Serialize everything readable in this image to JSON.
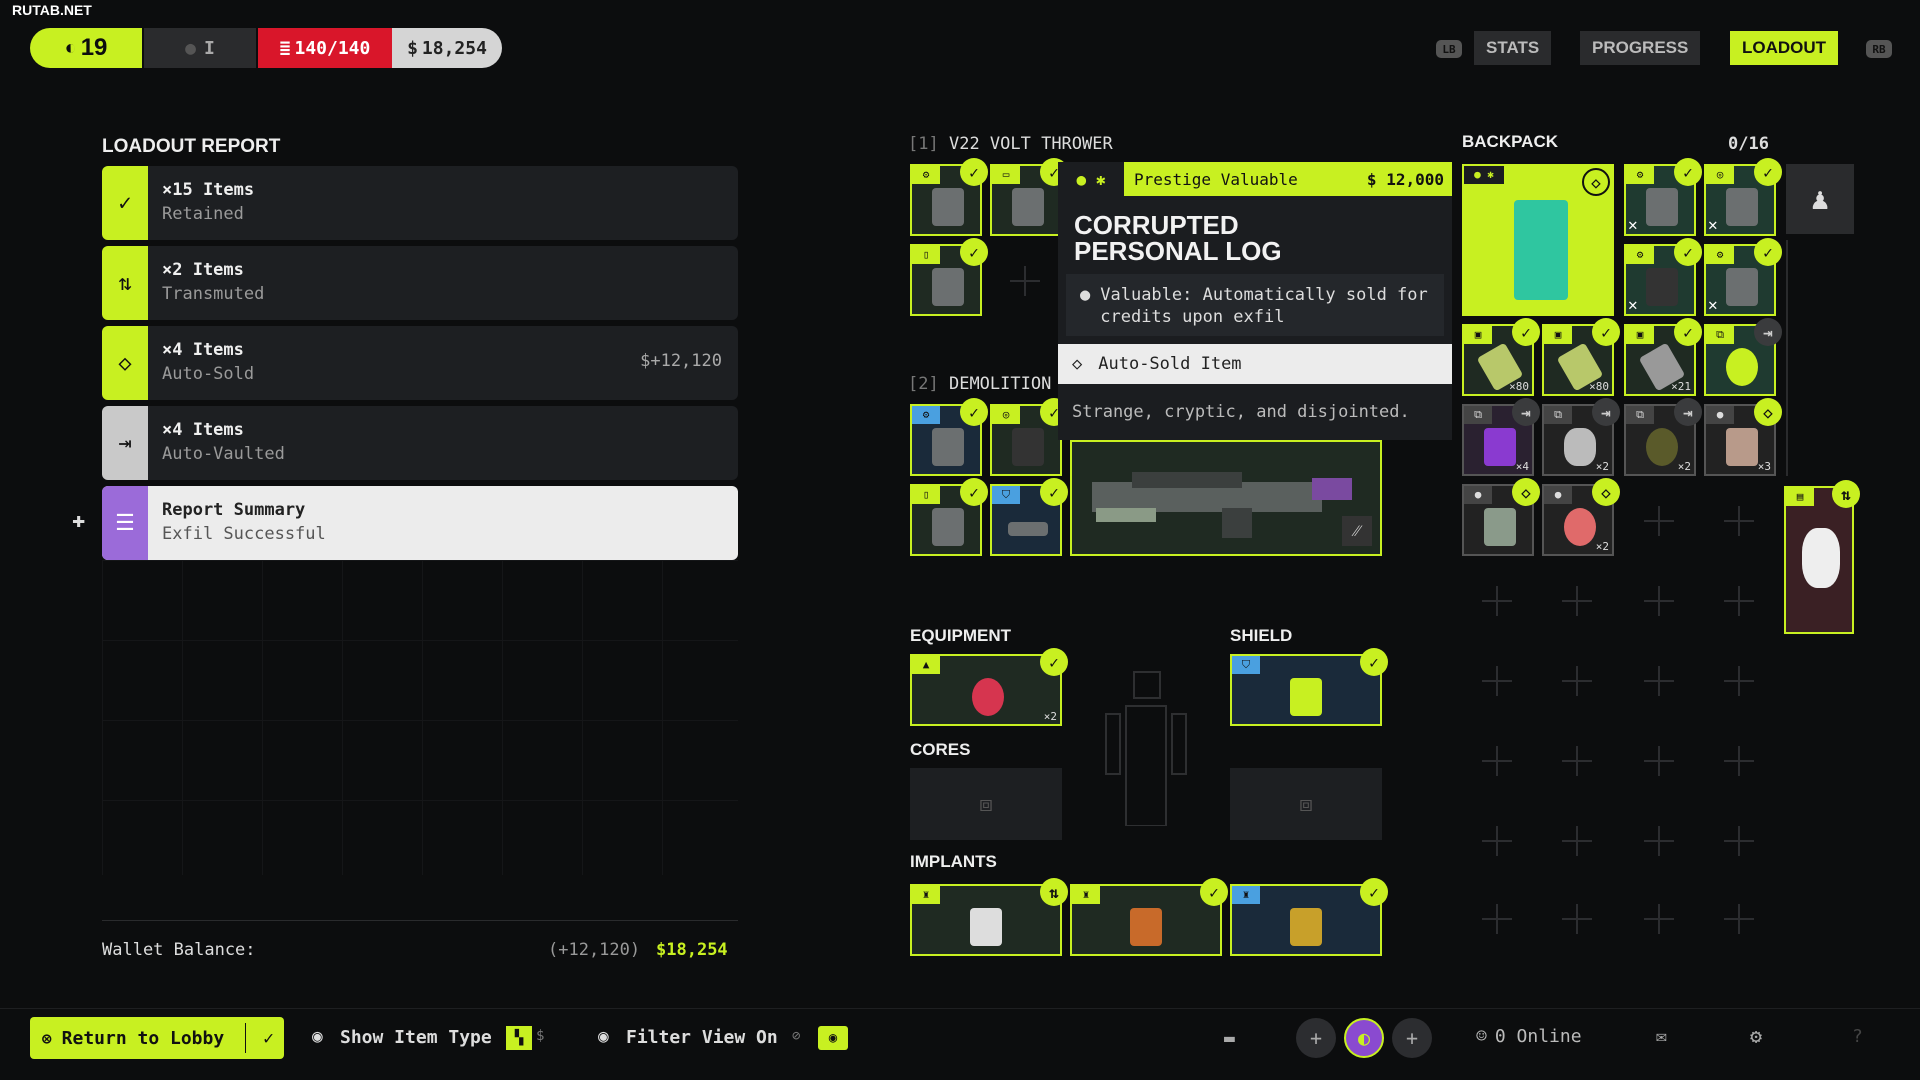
{
  "watermark": "RUTAB.NET",
  "topbar": {
    "level": "19",
    "rank": "I",
    "stash": "140/140",
    "credits": "18,254",
    "tabs": [
      "STATS",
      "PROGRESS",
      "LOADOUT"
    ],
    "active_tab": "LOADOUT",
    "lb": "LB",
    "rb": "RB"
  },
  "report": {
    "title": "LOADOUT REPORT",
    "rows": [
      {
        "title": "×15 Items",
        "sub": "Retained",
        "icon": "check-icon",
        "color": "#c8f021"
      },
      {
        "title": "×2 Items",
        "sub": "Transmuted",
        "icon": "transmute-icon",
        "color": "#c8f021"
      },
      {
        "title": "×4 Items",
        "sub": "Auto-Sold",
        "icon": "diamond-icon",
        "color": "#c8f021",
        "amount": "+12,120"
      },
      {
        "title": "×4 Items",
        "sub": "Auto-Vaulted",
        "icon": "vault-icon",
        "color": "#c9c9c9"
      },
      {
        "title": "Report Summary",
        "sub": "Exfil Successful",
        "icon": "list-icon",
        "color": "#9b6bd9"
      }
    ],
    "wallet_label": "Wallet Balance:",
    "wallet_delta": "(+12,120)",
    "wallet_total": "18,254"
  },
  "loadout": {
    "weapon1": {
      "index": "[1]",
      "name": "V22 VOLT THROWER"
    },
    "weapon2": {
      "index": "[2]",
      "name": "DEMOLITION"
    },
    "equipment": "EQUIPMENT",
    "shield": "SHIELD",
    "cores": "CORES",
    "implants": "IMPLANTS",
    "equipment_count": "×2"
  },
  "backpack": {
    "title": "BACKPACK",
    "capacity": "0/16",
    "counts": [
      "×80",
      "×80",
      "×21",
      "×4",
      "×2",
      "×2",
      "×3",
      "×2"
    ]
  },
  "tooltip": {
    "rarity": "Prestige Valuable",
    "value": "12,000",
    "title_line1": "CORRUPTED",
    "title_line2": "PERSONAL LOG",
    "desc": "Valuable: Automatically sold for credits upon exfil",
    "auto": "Auto-Sold Item",
    "flavor": "Strange, cryptic, and disjointed."
  },
  "bottom": {
    "lobby": "Return to Lobby",
    "show_type": "Show Item Type",
    "filter": "Filter View On",
    "online": "0 Online"
  },
  "colors": {
    "accent": "#c8f021",
    "danger": "#d9162a",
    "bg": "#0c0d0e"
  }
}
